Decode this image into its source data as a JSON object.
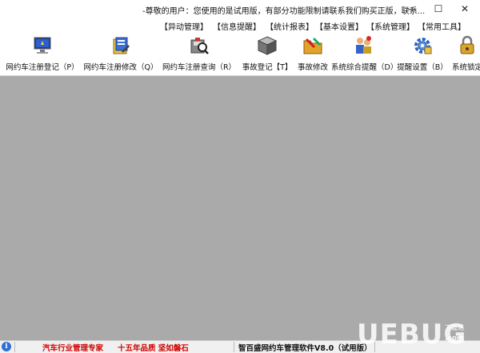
{
  "window": {
    "title": "-尊敬的用户：您使用的是试用版，有部分功能限制请联系我们购买正版，联系...",
    "minimize": "—",
    "maximize": "☐",
    "close": "✕"
  },
  "menu": [
    {
      "label": "【异动管理】"
    },
    {
      "label": "【信息提醒】"
    },
    {
      "label": "【统计报表】"
    },
    {
      "label": "【基本设置】"
    },
    {
      "label": "【系统管理】"
    },
    {
      "label": "【常用工具】"
    }
  ],
  "toolbar": [
    {
      "label": "网约车注册登记（P）",
      "icon": "monitor-icon"
    },
    {
      "label": "网约车注册修改（Q）",
      "icon": "edit-doc-icon"
    },
    {
      "label": "网约车注册查询（R）",
      "icon": "disk-search-icon"
    },
    {
      "label": "事故登记【T】",
      "icon": "cube-icon"
    },
    {
      "label": "事故修改",
      "icon": "folder-edit-icon"
    },
    {
      "label": "系统综合提醒（D）",
      "icon": "people-alert-icon"
    },
    {
      "label": "提醒设置（B）",
      "icon": "gear-icon"
    },
    {
      "label": "系统锁定",
      "icon": "lock-icon"
    }
  ],
  "status": {
    "info_icon": "i",
    "slogan1": "汽车行业管理专家",
    "slogan2": "十五年品质 坚如磐石",
    "product": "智百盛网约车管理软件V8.0（试用版）"
  },
  "watermark": {
    "logo": "UEBUG",
    "sub": "下载站",
    "domain": ".com"
  },
  "colors": {
    "workspace": "#aaaaaa",
    "status_red": "#d10000"
  }
}
